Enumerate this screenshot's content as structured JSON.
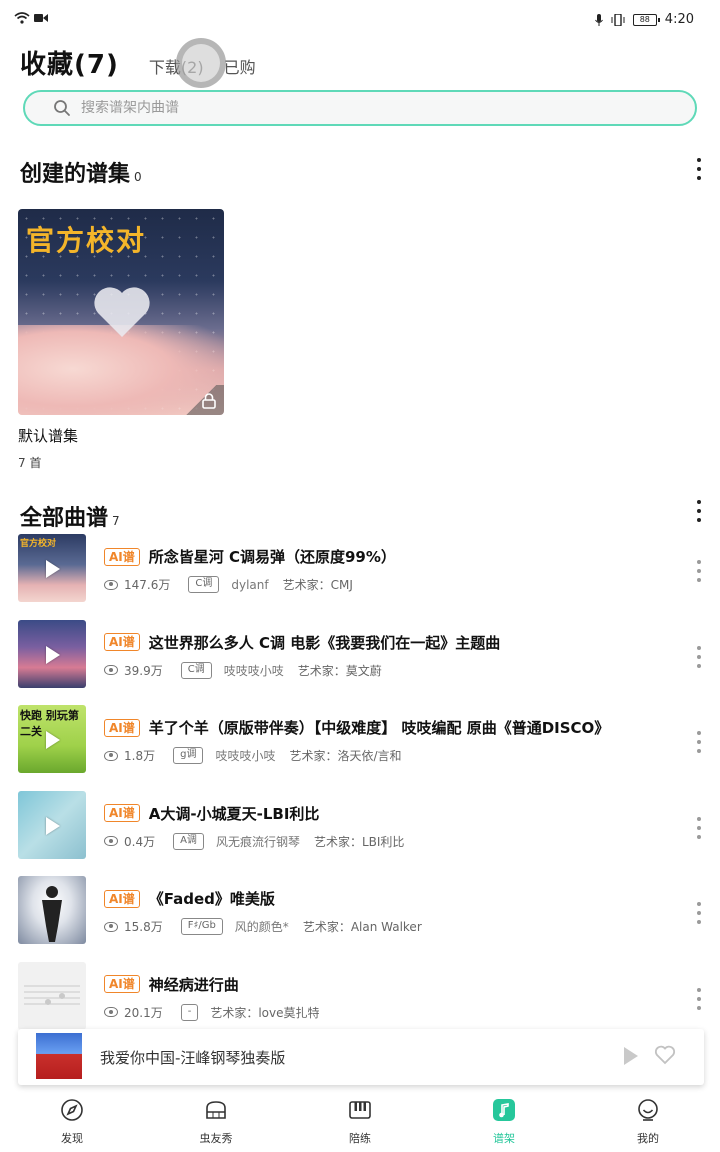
{
  "status_bar": {
    "time": "4:20",
    "battery": "88"
  },
  "header": {
    "tabs": [
      {
        "label": "收藏",
        "count": "(7)"
      },
      {
        "label": "下载",
        "count": "(2)"
      },
      {
        "label": "已购"
      }
    ]
  },
  "search": {
    "placeholder": "搜索谱架内曲谱"
  },
  "created_sets": {
    "title": "创建的谱集",
    "count": "0",
    "items": [
      {
        "cover_text": "官方校对",
        "name": "默认谱集",
        "meta": "7 首"
      }
    ]
  },
  "all_scores": {
    "title": "全部曲谱",
    "count": "7",
    "items": [
      {
        "badge": "AI谱",
        "title": "所念皆星河 C调易弹（还原度99%）",
        "views": "147.6万",
        "key": "C调",
        "uploader": "dylanf",
        "artist": "艺术家：CMJ",
        "thumb_label": "官方校对"
      },
      {
        "badge": "AI谱",
        "title": "这世界那么多人  C调  电影《我要我们在一起》主题曲",
        "views": "39.9万",
        "key": "C调",
        "uploader": "吱吱吱小吱",
        "artist": "艺术家：莫文蔚"
      },
      {
        "badge": "AI谱",
        "title": "羊了个羊（原版带伴奏）【中级难度】 吱吱编配 原曲《普通DISCO》",
        "views": "1.8万",
        "key": "g调",
        "uploader": "吱吱吱小吱",
        "artist": "艺术家：洛天依/言和",
        "thumb_label": "快跑 别玩第二关"
      },
      {
        "badge": "AI谱",
        "title": "A大调-小城夏天-LBI利比",
        "views": "0.4万",
        "key": "A调",
        "uploader": "风无痕流行钢琴",
        "artist": "艺术家：LBI利比"
      },
      {
        "badge": "AI谱",
        "title": "《Faded》唯美版",
        "views": "15.8万",
        "key": "F♯/Gb",
        "uploader": "风的颜色*",
        "artist": "艺术家：Alan Walker"
      },
      {
        "badge": "AI谱",
        "title": "神经病进行曲",
        "views": "20.1万",
        "key": "-",
        "uploader": "",
        "artist": "艺术家：love莫扎特"
      }
    ]
  },
  "now_playing": {
    "title": "我爱你中国-汪峰钢琴独奏版"
  },
  "bottom_nav": [
    {
      "label": "发现",
      "icon": "compass-icon"
    },
    {
      "label": "虫友秀",
      "icon": "piano-icon"
    },
    {
      "label": "陪练",
      "icon": "keys-icon"
    },
    {
      "label": "谱架",
      "icon": "music-note-icon",
      "active": true
    },
    {
      "label": "我的",
      "icon": "profile-icon"
    }
  ],
  "colors": {
    "accent": "#26c79b",
    "ai_badge": "#f0862a"
  }
}
